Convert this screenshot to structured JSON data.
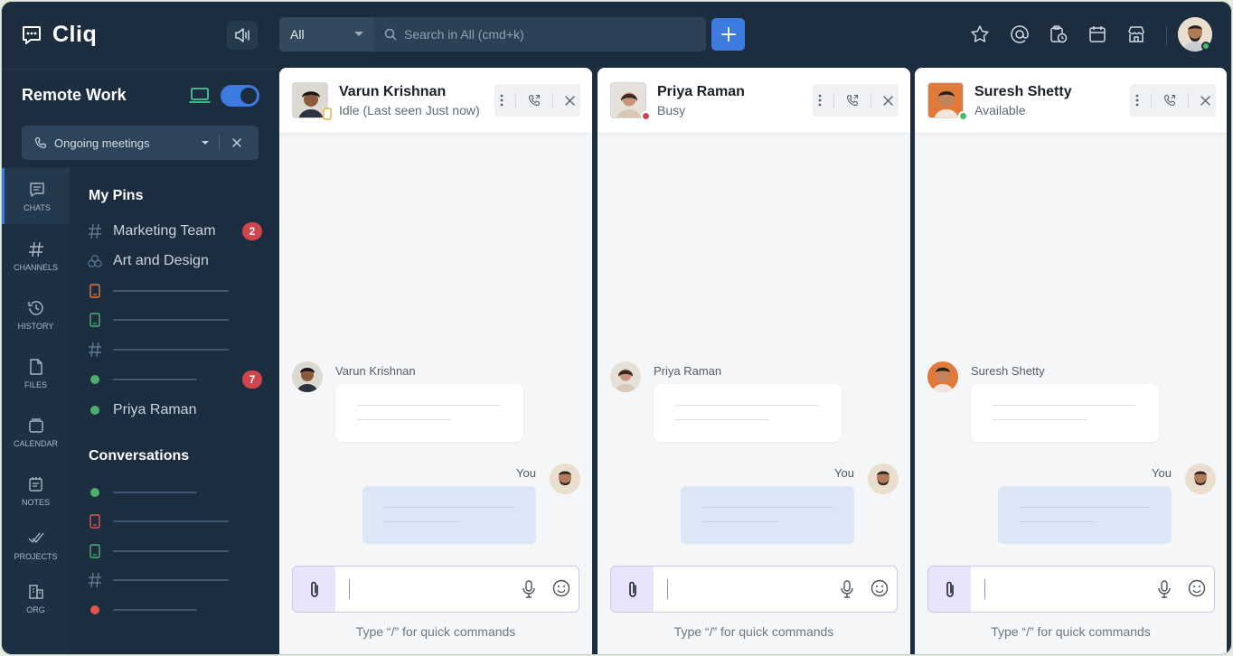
{
  "app": {
    "name": "Cliq"
  },
  "search": {
    "scope": "All",
    "placeholder": "Search in All (cmd+k)"
  },
  "workspace": {
    "name": "Remote Work"
  },
  "meeting_filter": {
    "label": "Ongoing meetings"
  },
  "rail": [
    {
      "label": "CHATS",
      "icon": "chat-icon",
      "active": true
    },
    {
      "label": "CHANNELS",
      "icon": "hash-icon"
    },
    {
      "label": "HISTORY",
      "icon": "history-icon"
    },
    {
      "label": "FILES",
      "icon": "file-icon"
    },
    {
      "label": "CALENDAR",
      "icon": "calendar-icon"
    },
    {
      "label": "NOTES",
      "icon": "notes-icon"
    },
    {
      "label": "PROJECTS",
      "icon": "projects-icon"
    },
    {
      "label": "ORG",
      "icon": "org-icon"
    }
  ],
  "pins": {
    "title": "My Pins",
    "items": [
      {
        "label": "Marketing Team",
        "icon": "hash-icon",
        "badge": "2"
      },
      {
        "label": "Art and Design",
        "icon": "group-icon"
      },
      {
        "label": "",
        "icon": "mobile-icon",
        "status_color": "#e07a3a"
      },
      {
        "label": "",
        "icon": "mobile-icon",
        "status_color": "#4caf6a"
      },
      {
        "label": "",
        "icon": "hash-icon"
      },
      {
        "label": "",
        "icon": "dot-icon",
        "status_color": "#4caf6a",
        "badge": "7"
      },
      {
        "label": "Priya Raman",
        "icon": "dot-icon",
        "status_color": "#4caf6a"
      }
    ]
  },
  "conversations": {
    "title": "Conversations",
    "items": [
      {
        "icon": "dot-icon",
        "status_color": "#4caf6a"
      },
      {
        "icon": "mobile-icon",
        "status_color": "#e0554c"
      },
      {
        "icon": "mobile-icon",
        "status_color": "#4caf6a"
      },
      {
        "icon": "hash-icon"
      },
      {
        "icon": "dot-icon",
        "status_color": "#e0554c"
      }
    ]
  },
  "chats": [
    {
      "name": "Varun Krishnan",
      "status": "Idle (Last seen Just now)",
      "status_color": "#e8a93a",
      "sender": "Varun Krishnan",
      "you_label": "You",
      "hint": "Type “/” for quick commands"
    },
    {
      "name": "Priya Raman",
      "status": "Busy",
      "status_color": "#d0454c",
      "sender": "Priya Raman",
      "you_label": "You",
      "hint": "Type “/” for quick commands"
    },
    {
      "name": "Suresh Shetty",
      "status": "Available",
      "status_color": "#49b96f",
      "sender": "Suresh Shetty",
      "you_label": "You",
      "hint": "Type “/” for quick commands"
    }
  ],
  "colors": {
    "accent": "#3d7be0",
    "sidebar": "#1b2d3f",
    "badge": "#d0454c"
  }
}
